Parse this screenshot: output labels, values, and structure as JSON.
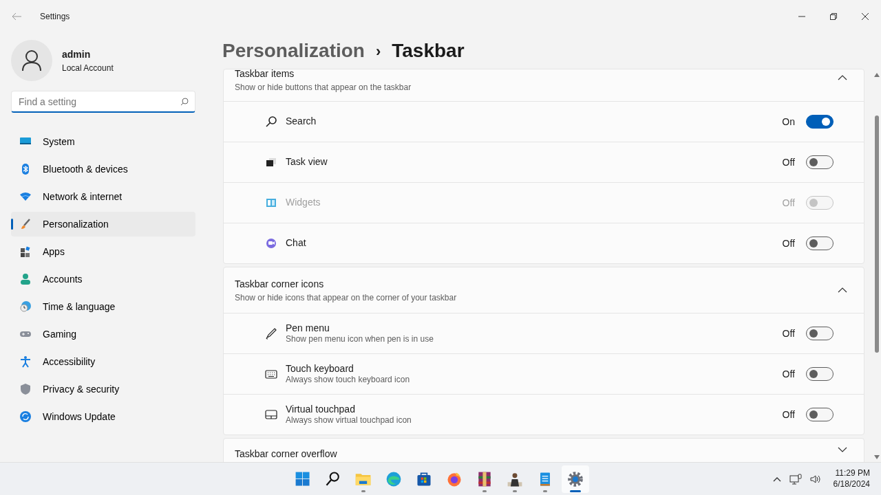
{
  "window": {
    "title": "Settings"
  },
  "account": {
    "name": "admin",
    "type": "Local Account"
  },
  "search": {
    "placeholder": "Find a setting"
  },
  "sidebar": {
    "items": [
      {
        "label": "System",
        "selected": false
      },
      {
        "label": "Bluetooth & devices",
        "selected": false
      },
      {
        "label": "Network & internet",
        "selected": false
      },
      {
        "label": "Personalization",
        "selected": true
      },
      {
        "label": "Apps",
        "selected": false
      },
      {
        "label": "Accounts",
        "selected": false
      },
      {
        "label": "Time & language",
        "selected": false
      },
      {
        "label": "Gaming",
        "selected": false
      },
      {
        "label": "Accessibility",
        "selected": false
      },
      {
        "label": "Privacy & security",
        "selected": false
      },
      {
        "label": "Windows Update",
        "selected": false
      }
    ]
  },
  "breadcrumb": {
    "parent": "Personalization",
    "separator": "›",
    "current": "Taskbar"
  },
  "sections": [
    {
      "title": "Taskbar items",
      "description": "Show or hide buttons that appear on the taskbar",
      "expanded": true,
      "items": [
        {
          "label": "Search",
          "state_text": "On",
          "on": true,
          "disabled": false
        },
        {
          "label": "Task view",
          "state_text": "Off",
          "on": false,
          "disabled": false
        },
        {
          "label": "Widgets",
          "state_text": "Off",
          "on": false,
          "disabled": true
        },
        {
          "label": "Chat",
          "state_text": "Off",
          "on": false,
          "disabled": false
        }
      ]
    },
    {
      "title": "Taskbar corner icons",
      "description": "Show or hide icons that appear on the corner of your taskbar",
      "expanded": true,
      "items": [
        {
          "label": "Pen menu",
          "description": "Show pen menu icon when pen is in use",
          "state_text": "Off",
          "on": false,
          "disabled": false
        },
        {
          "label": "Touch keyboard",
          "description": "Always show touch keyboard icon",
          "state_text": "Off",
          "on": false,
          "disabled": false
        },
        {
          "label": "Virtual touchpad",
          "description": "Always show virtual touchpad icon",
          "state_text": "Off",
          "on": false,
          "disabled": false
        }
      ]
    },
    {
      "title": "Taskbar corner overflow",
      "expanded": false
    }
  ],
  "taskbar": {
    "apps": [
      {
        "running": false,
        "active": false
      },
      {
        "running": false,
        "active": false
      },
      {
        "running": true,
        "active": false
      },
      {
        "running": false,
        "active": false
      },
      {
        "running": false,
        "active": false
      },
      {
        "running": false,
        "active": false
      },
      {
        "running": true,
        "active": false
      },
      {
        "running": true,
        "active": false
      },
      {
        "running": true,
        "active": false
      },
      {
        "running": true,
        "active": true
      }
    ],
    "time": "11:29 PM",
    "date": "6/18/2024"
  }
}
